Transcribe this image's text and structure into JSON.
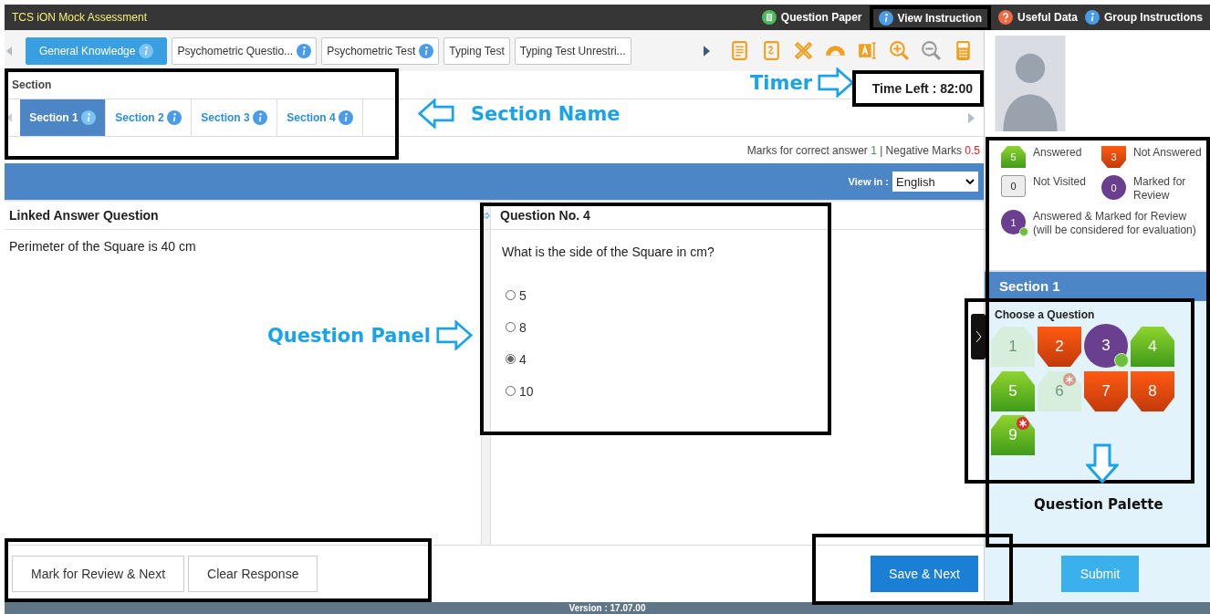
{
  "header": {
    "title": "TCS iON Mock Assessment",
    "links": [
      {
        "label": "Question Paper",
        "kind": "paper"
      },
      {
        "label": "View Instruction",
        "kind": "info"
      },
      {
        "label": "Useful Data",
        "kind": "help"
      },
      {
        "label": "Group Instructions",
        "kind": "info"
      }
    ]
  },
  "test_tabs": [
    {
      "label": "General Knowledge",
      "info": true,
      "selected": true
    },
    {
      "label": "Psychometric Questio...",
      "info": true,
      "selected": false
    },
    {
      "label": "Psychometric Test",
      "info": true,
      "selected": false
    },
    {
      "label": "Typing Test",
      "info": false,
      "selected": false
    },
    {
      "label": "Typing Test Unrestri...",
      "info": false,
      "selected": false
    }
  ],
  "section": {
    "heading": "Section",
    "tabs": [
      {
        "label": "Section 1",
        "selected": true
      },
      {
        "label": "Section 2",
        "selected": false
      },
      {
        "label": "Section 3",
        "selected": false
      },
      {
        "label": "Section 4",
        "selected": false
      }
    ]
  },
  "timer": "Time Left : 82:00",
  "marks": {
    "correct_label": "Marks for correct answer",
    "correct": "1",
    "separator": "|",
    "negative_label": "Negative Marks",
    "negative": "0.5"
  },
  "view_in": {
    "label": "View in :",
    "value": "English"
  },
  "linked": {
    "title": "Linked Answer Question",
    "text": "Perimeter of the Square is 40 cm"
  },
  "question": {
    "title": "Question No. 4",
    "text": "What is the side of the Square in cm?",
    "options": [
      {
        "label": "5",
        "selected": false
      },
      {
        "label": "8",
        "selected": false
      },
      {
        "label": "4",
        "selected": true
      },
      {
        "label": "10",
        "selected": false
      }
    ]
  },
  "buttons": {
    "mark": "Mark for Review & Next",
    "clear": "Clear Response",
    "save": "Save & Next",
    "submit": "Submit"
  },
  "version": "Version : 17.07.00",
  "legend": [
    {
      "kind": "answered",
      "count": "5",
      "label": "Answered"
    },
    {
      "kind": "not_answered",
      "count": "3",
      "label": "Not Answered"
    },
    {
      "kind": "not_visited",
      "count": "0",
      "label": "Not Visited"
    },
    {
      "kind": "marked",
      "count": "0",
      "label": "Marked for Review"
    },
    {
      "kind": "answered_marked",
      "count": "1",
      "label": "Answered & Marked for Review (will be considered for evaluation)"
    }
  ],
  "palette": {
    "section": "Section 1",
    "heading": "Choose a Question",
    "questions": [
      {
        "number": "1",
        "kind": "faded",
        "starred": false
      },
      {
        "number": "2",
        "kind": "not_answered",
        "starred": false
      },
      {
        "number": "3",
        "kind": "answered_marked",
        "starred": false
      },
      {
        "number": "4",
        "kind": "answered",
        "starred": false
      },
      {
        "number": "5",
        "kind": "answered",
        "starred": false
      },
      {
        "number": "6",
        "kind": "faded",
        "starred": true
      },
      {
        "number": "7",
        "kind": "not_answered",
        "starred": false
      },
      {
        "number": "8",
        "kind": "not_answered",
        "starred": false
      },
      {
        "number": "9",
        "kind": "answered",
        "starred": true
      }
    ]
  },
  "annotations": [
    "Timer",
    "Section Name",
    "Question Panel",
    "Question Palette"
  ]
}
